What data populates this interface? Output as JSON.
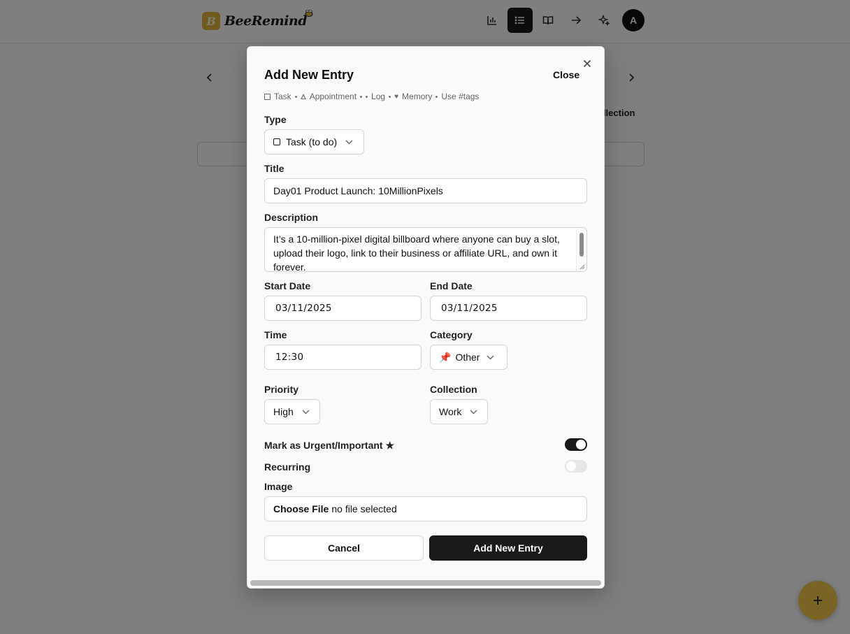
{
  "app": {
    "brand": "BeeRemind",
    "logo_letter": "B",
    "avatar_initial": "A",
    "bg_collection_label": "ollection",
    "nav_icons": [
      "bar-chart-icon",
      "list-icon",
      "book-icon",
      "arrow-right-icon",
      "sparkles-icon"
    ]
  },
  "modal": {
    "title": "Add New Entry",
    "close_label": "Close",
    "legend": {
      "task": "Task",
      "appointment": "Appointment",
      "log": "Log",
      "memory": "Memory",
      "tags": "Use #tags"
    },
    "type": {
      "label": "Type",
      "value": "Task (to do)"
    },
    "title_field": {
      "label": "Title",
      "value": "Day01 Product Launch: 10MillionPixels"
    },
    "description": {
      "label": "Description",
      "value": "It’s a 10-million-pixel digital billboard where anyone can buy a slot, upload their logo, link to their business or affiliate URL, and own it forever."
    },
    "start_date": {
      "label": "Start Date",
      "value": "03/11/2025"
    },
    "end_date": {
      "label": "End Date",
      "value": "03/11/2025"
    },
    "time": {
      "label": "Time",
      "value": "12:30"
    },
    "category": {
      "label": "Category",
      "emoji": "📌",
      "value": "Other"
    },
    "priority": {
      "label": "Priority",
      "value": "High"
    },
    "collection": {
      "label": "Collection",
      "value": "Work"
    },
    "urgent": {
      "label": "Mark as Urgent/Important",
      "star": "★",
      "on": true
    },
    "recurring": {
      "label": "Recurring",
      "on": false
    },
    "image": {
      "label": "Image",
      "button": "Choose File",
      "status": "no file selected"
    },
    "cancel_label": "Cancel",
    "submit_label": "Add New Entry"
  }
}
